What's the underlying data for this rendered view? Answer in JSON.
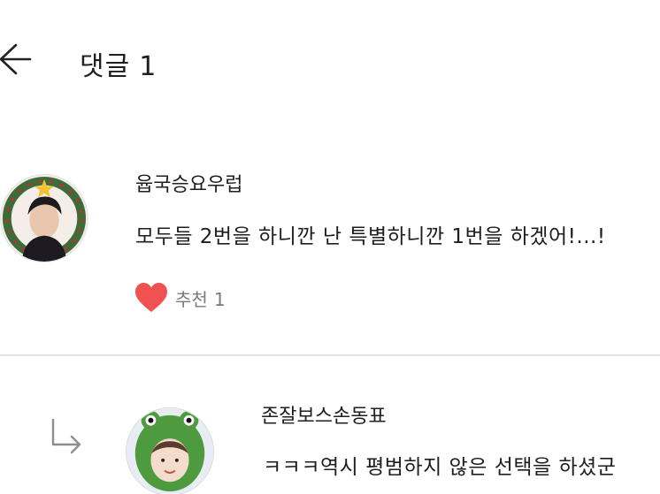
{
  "header": {
    "title": "댓글",
    "count": "1",
    "back_icon": "arrow-left-icon"
  },
  "comments": [
    {
      "username": "윱국승요우럽",
      "text": "모두들 2번을 하니깐 난 특별하니깐 1번을 하겠어!...!",
      "like_label": "추천",
      "like_count": "1",
      "like_icon": "heart-icon",
      "like_color": "#f05252"
    },
    {
      "username": "존잘보스손동표",
      "text": "ㅋㅋㅋ역시 평범하지 않은 선택을 하셨군",
      "reply_icon": "reply-arrow-icon"
    }
  ]
}
